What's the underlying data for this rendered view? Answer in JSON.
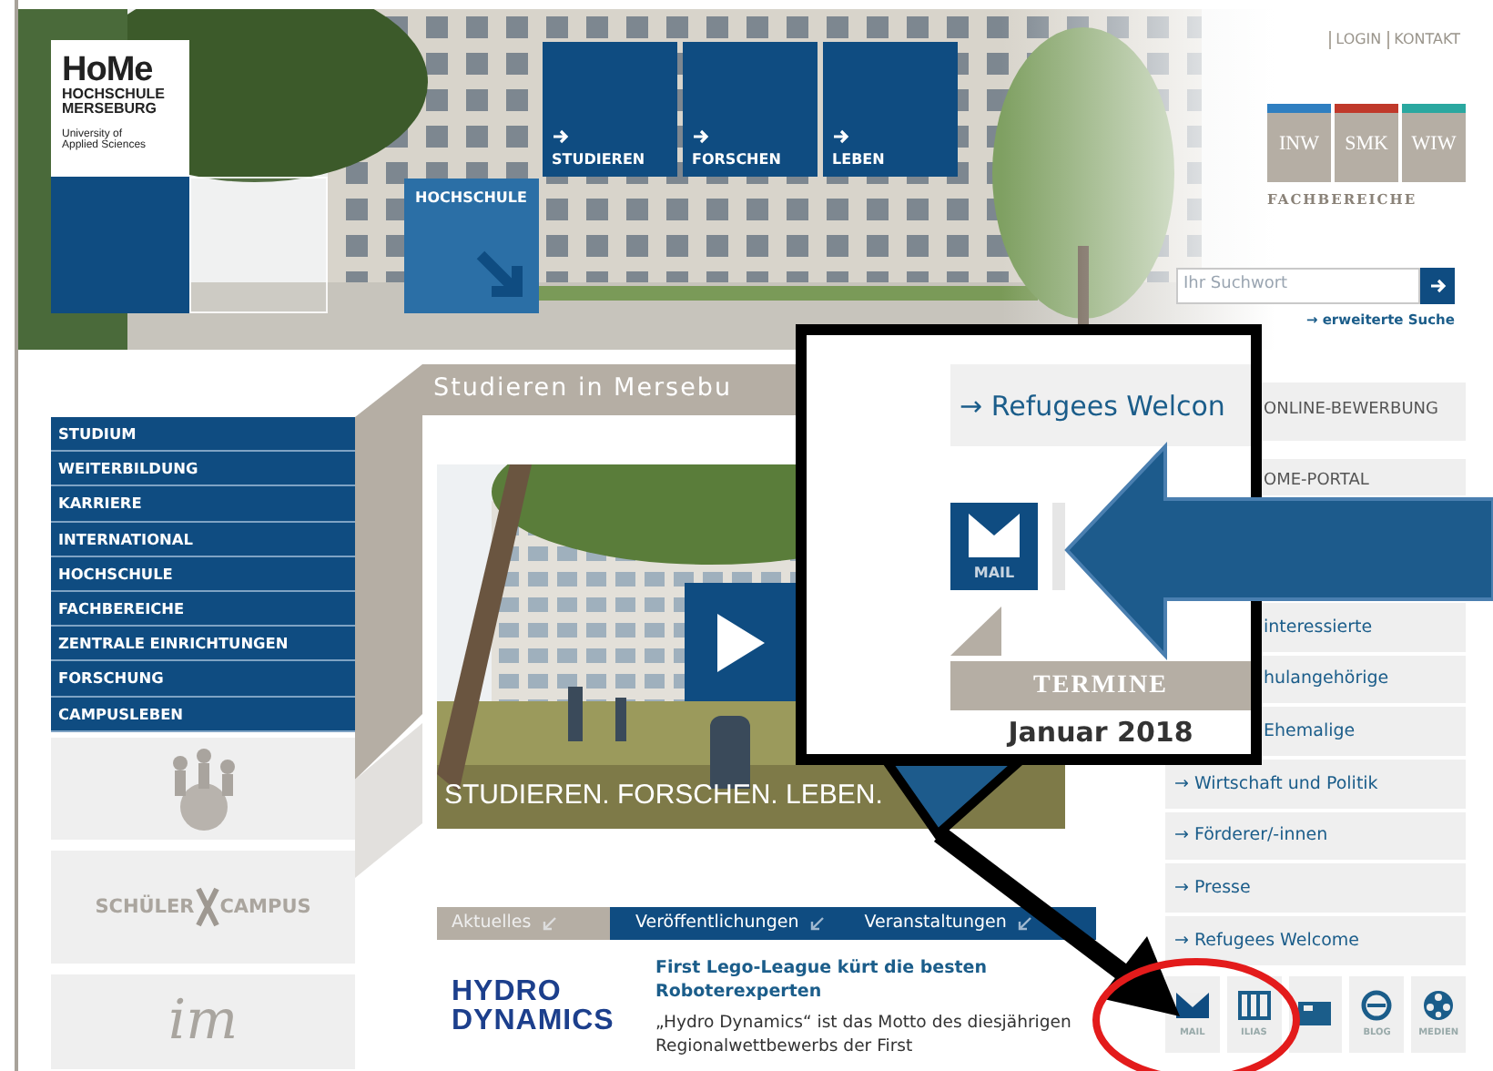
{
  "header": {
    "logo": {
      "name": "HoMe",
      "lines": [
        "HOCHSCHULE",
        "MERSEBURG"
      ],
      "subtitle": [
        "University of",
        "Applied Sciences"
      ]
    },
    "hochschule_tile": "HOCHSCHULE",
    "nav_tiles": [
      "STUDIEREN",
      "FORSCHEN",
      "LEBEN"
    ],
    "top_links": [
      "LOGIN",
      "KONTAKT"
    ],
    "faculties": [
      {
        "label": "INW",
        "color": "#2f7fc1"
      },
      {
        "label": "SMK",
        "color": "#c0392b"
      },
      {
        "label": "WIW",
        "color": "#2aa8a0"
      }
    ],
    "faculties_label": "FACHBEREICHE",
    "search": {
      "placeholder": "Ihr Suchwort",
      "advanced_link": "→ erweiterte Suche"
    }
  },
  "left_nav": [
    "STUDIUM",
    "WEITERBILDUNG",
    "KARRIERE",
    "INTERNATIONAL",
    "HOCHSCHULE",
    "FACHBEREICHE",
    "ZENTRALE EINRICHTUNGEN",
    "FORSCHUNG",
    "CAMPUSLEBEN"
  ],
  "partner_logos": [
    {
      "kind": "people"
    },
    {
      "kind": "campus",
      "words": [
        "SCHÜLER",
        "CAMPUS"
      ]
    },
    {
      "kind": "script",
      "text": "im"
    }
  ],
  "main": {
    "title": "Studieren in Mersebu",
    "video": {
      "caption": "STUDIEREN. FORSCHEN. LEBEN."
    },
    "news_tabs": [
      {
        "label": "Aktuelles",
        "selected": true
      },
      {
        "label": "Veröffentlichungen",
        "selected": false
      },
      {
        "label": "Veranstaltungen",
        "selected": false
      }
    ],
    "news": {
      "logo": [
        "HYDRO",
        "DYNAMICS"
      ],
      "title": "First Lego-League kürt die besten Roboterexperten",
      "text": "„Hydro Dynamics“ ist das Motto des diesjährigen Regionalwettbewerbs der First"
    }
  },
  "right": {
    "buttons": [
      {
        "label": "ONLINE-BEWERBUNG"
      },
      {
        "label": "OME-PORTAL"
      }
    ],
    "links": [
      {
        "kind": "partial",
        "label": "interessierte"
      },
      {
        "kind": "partial",
        "label": "hulangehörige"
      },
      {
        "kind": "partial",
        "label": "Ehemalige"
      },
      {
        "kind": "full",
        "label": "→ Wirtschaft und Politik"
      },
      {
        "kind": "full",
        "label": "→ Förderer/-innen"
      },
      {
        "kind": "full",
        "label": "→ Presse"
      },
      {
        "kind": "full",
        "label": "→ Refugees Welcome"
      }
    ],
    "quick_links": [
      {
        "kind": "mail",
        "label": "MAIL"
      },
      {
        "kind": "ilias",
        "label": "ILIAS"
      },
      {
        "kind": "screen"
      },
      {
        "kind": "blog",
        "label": "BLOG"
      },
      {
        "kind": "media",
        "label": "MEDIEN"
      }
    ]
  },
  "callout": {
    "link": "→ Refugees Welcon",
    "mail_tile": "MAIL",
    "termine": "TERMINE",
    "month": "Januar 2018"
  }
}
